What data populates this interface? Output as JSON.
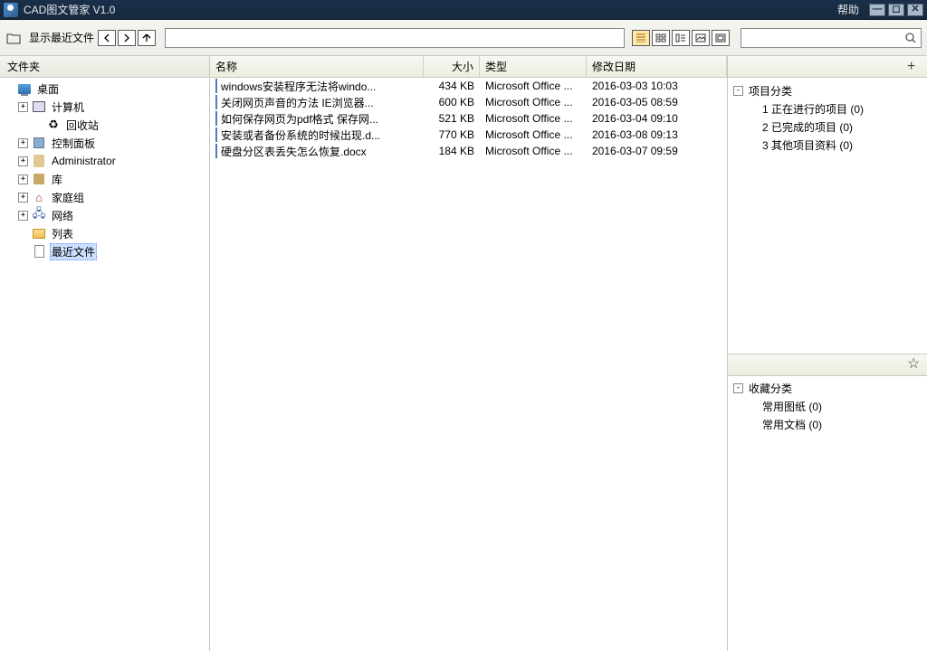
{
  "titlebar": {
    "title": "CAD图文管家 V1.0",
    "help": "帮助"
  },
  "toolbar": {
    "breadcrumb": "显示最近文件"
  },
  "left_panel": {
    "header": "文件夹",
    "tree": [
      {
        "expander": "",
        "indent": 0,
        "icon": "desktop",
        "label": "桌面"
      },
      {
        "expander": "+",
        "indent": 1,
        "icon": "computer",
        "label": "计算机"
      },
      {
        "expander": "",
        "indent": 2,
        "icon": "recycle",
        "label": "回收站"
      },
      {
        "expander": "+",
        "indent": 1,
        "icon": "cpanel",
        "label": "控制面板"
      },
      {
        "expander": "+",
        "indent": 1,
        "icon": "user",
        "label": "Administrator"
      },
      {
        "expander": "+",
        "indent": 1,
        "icon": "lib",
        "label": "库"
      },
      {
        "expander": "+",
        "indent": 1,
        "icon": "home",
        "label": "家庭组"
      },
      {
        "expander": "+",
        "indent": 1,
        "icon": "network",
        "label": "网络"
      },
      {
        "expander": "",
        "indent": 1,
        "icon": "folder",
        "label": "列表"
      },
      {
        "expander": "",
        "indent": 1,
        "icon": "file",
        "label": "最近文件",
        "selected": true
      }
    ]
  },
  "file_list": {
    "columns": {
      "name": "名称",
      "size": "大小",
      "type": "类型",
      "date": "修改日期"
    },
    "rows": [
      {
        "name": "windows安装程序无法将windo...",
        "size": "434 KB",
        "type": "Microsoft Office ...",
        "date": "2016-03-03 10:03"
      },
      {
        "name": "关闭网页声音的方法 IE浏览器...",
        "size": "600 KB",
        "type": "Microsoft Office ...",
        "date": "2016-03-05 08:59"
      },
      {
        "name": "如何保存网页为pdf格式 保存网...",
        "size": "521 KB",
        "type": "Microsoft Office ...",
        "date": "2016-03-04 09:10"
      },
      {
        "name": "安装或者备份系统的时候出现.d...",
        "size": "770 KB",
        "type": "Microsoft Office ...",
        "date": "2016-03-08 09:13"
      },
      {
        "name": "硬盘分区表丢失怎么恢复.docx",
        "size": "184 KB",
        "type": "Microsoft Office ...",
        "date": "2016-03-07 09:59"
      }
    ]
  },
  "right_panel": {
    "project": {
      "title": "项目分类",
      "items": [
        "1 正在进行的项目  (0)",
        "2 已完成的项目  (0)",
        "3 其他项目资料  (0)"
      ]
    },
    "favorites": {
      "title": "收藏分类",
      "items": [
        "常用图纸  (0)",
        "常用文档  (0)"
      ]
    }
  }
}
